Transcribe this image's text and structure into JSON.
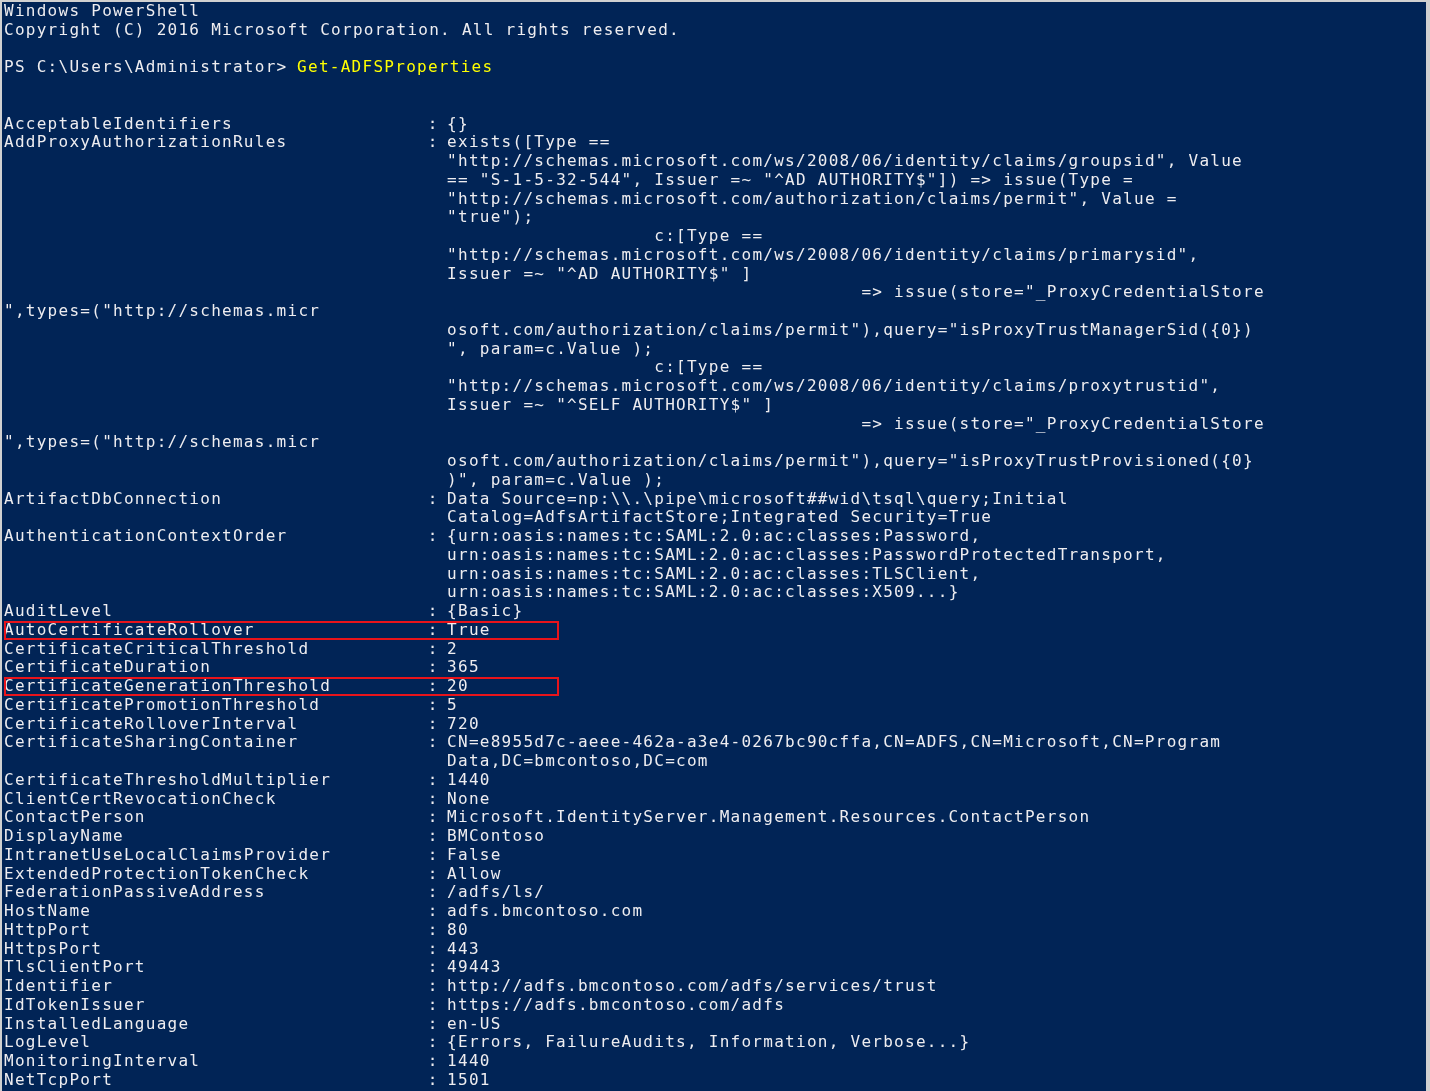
{
  "window": {
    "title": "Windows PowerShell"
  },
  "lines": [
    {
      "kind": "raw",
      "text": "Copyright (C) 2016 Microsoft Corporation. All rights reserved."
    },
    {
      "kind": "blank"
    },
    {
      "kind": "prompt",
      "prompt": "PS C:\\Users\\Administrator>",
      "command": "Get-ADFSProperties"
    },
    {
      "kind": "blank"
    },
    {
      "kind": "blank"
    },
    {
      "kind": "property",
      "name": "AcceptableIdentifiers",
      "sep": ":",
      "value": "{}",
      "highlighted": false
    },
    {
      "kind": "property",
      "name": "AddProxyAuthorizationRules",
      "sep": ":",
      "value": "exists([Type ==",
      "highlighted": false
    },
    {
      "kind": "cont",
      "text": "\"http://schemas.microsoft.com/ws/2008/06/identity/claims/groupsid\", Value"
    },
    {
      "kind": "cont",
      "text": "== \"S-1-5-32-544\", Issuer =~ \"^AD AUTHORITY$\"]) => issue(Type ="
    },
    {
      "kind": "cont",
      "text": "\"http://schemas.microsoft.com/authorization/claims/permit\", Value ="
    },
    {
      "kind": "cont",
      "text": "\"true\");"
    },
    {
      "kind": "cont",
      "text": "                   c:[Type =="
    },
    {
      "kind": "cont",
      "text": "\"http://schemas.microsoft.com/ws/2008/06/identity/claims/primarysid\","
    },
    {
      "kind": "cont",
      "text": "Issuer =~ \"^AD AUTHORITY$\" ]"
    },
    {
      "kind": "cont",
      "text": "                                      => issue(store=\"_ProxyCredentialStore"
    },
    {
      "kind": "raw",
      "text": "\",types=(\"http://schemas.micr"
    },
    {
      "kind": "cont",
      "text": "osoft.com/authorization/claims/permit\"),query=\"isProxyTrustManagerSid({0})"
    },
    {
      "kind": "cont",
      "text": "\", param=c.Value );"
    },
    {
      "kind": "cont",
      "text": "                   c:[Type =="
    },
    {
      "kind": "cont",
      "text": "\"http://schemas.microsoft.com/ws/2008/06/identity/claims/proxytrustid\","
    },
    {
      "kind": "cont",
      "text": "Issuer =~ \"^SELF AUTHORITY$\" ]"
    },
    {
      "kind": "cont",
      "text": "                                      => issue(store=\"_ProxyCredentialStore"
    },
    {
      "kind": "raw",
      "text": "\",types=(\"http://schemas.micr"
    },
    {
      "kind": "cont",
      "text": "osoft.com/authorization/claims/permit\"),query=\"isProxyTrustProvisioned({0}"
    },
    {
      "kind": "cont",
      "text": ")\", param=c.Value );"
    },
    {
      "kind": "property",
      "name": "ArtifactDbConnection",
      "sep": ":",
      "value": "Data Source=np:\\\\.\\pipe\\microsoft##wid\\tsql\\query;Initial",
      "highlighted": false
    },
    {
      "kind": "cont",
      "text": "Catalog=AdfsArtifactStore;Integrated Security=True"
    },
    {
      "kind": "property",
      "name": "AuthenticationContextOrder",
      "sep": ":",
      "value": "{urn:oasis:names:tc:SAML:2.0:ac:classes:Password,",
      "highlighted": false
    },
    {
      "kind": "cont",
      "text": "urn:oasis:names:tc:SAML:2.0:ac:classes:PasswordProtectedTransport,"
    },
    {
      "kind": "cont",
      "text": "urn:oasis:names:tc:SAML:2.0:ac:classes:TLSClient,"
    },
    {
      "kind": "cont",
      "text": "urn:oasis:names:tc:SAML:2.0:ac:classes:X509...}"
    },
    {
      "kind": "property",
      "name": "AuditLevel",
      "sep": ":",
      "value": "{Basic}",
      "highlighted": false
    },
    {
      "kind": "property",
      "name": "AutoCertificateRollover",
      "sep": ":",
      "value": "True",
      "highlighted": true
    },
    {
      "kind": "property",
      "name": "CertificateCriticalThreshold",
      "sep": ":",
      "value": "2",
      "highlighted": false
    },
    {
      "kind": "property",
      "name": "CertificateDuration",
      "sep": ":",
      "value": "365",
      "highlighted": false
    },
    {
      "kind": "property",
      "name": "CertificateGenerationThreshold",
      "sep": ":",
      "value": "20",
      "highlighted": true
    },
    {
      "kind": "property",
      "name": "CertificatePromotionThreshold",
      "sep": ":",
      "value": "5",
      "highlighted": false
    },
    {
      "kind": "property",
      "name": "CertificateRolloverInterval",
      "sep": ":",
      "value": "720",
      "highlighted": false
    },
    {
      "kind": "property",
      "name": "CertificateSharingContainer",
      "sep": ":",
      "value": "CN=e8955d7c-aeee-462a-a3e4-0267bc90cffa,CN=ADFS,CN=Microsoft,CN=Program",
      "highlighted": false
    },
    {
      "kind": "cont",
      "text": "Data,DC=bmcontoso,DC=com"
    },
    {
      "kind": "property",
      "name": "CertificateThresholdMultiplier",
      "sep": ":",
      "value": "1440",
      "highlighted": false
    },
    {
      "kind": "property",
      "name": "ClientCertRevocationCheck",
      "sep": ":",
      "value": "None",
      "highlighted": false
    },
    {
      "kind": "property",
      "name": "ContactPerson",
      "sep": ":",
      "value": "Microsoft.IdentityServer.Management.Resources.ContactPerson",
      "highlighted": false
    },
    {
      "kind": "property",
      "name": "DisplayName",
      "sep": ":",
      "value": "BMContoso",
      "highlighted": false
    },
    {
      "kind": "property",
      "name": "IntranetUseLocalClaimsProvider",
      "sep": ":",
      "value": "False",
      "highlighted": false
    },
    {
      "kind": "property",
      "name": "ExtendedProtectionTokenCheck",
      "sep": ":",
      "value": "Allow",
      "highlighted": false
    },
    {
      "kind": "property",
      "name": "FederationPassiveAddress",
      "sep": ":",
      "value": "/adfs/ls/",
      "highlighted": false
    },
    {
      "kind": "property",
      "name": "HostName",
      "sep": ":",
      "value": "adfs.bmcontoso.com",
      "highlighted": false
    },
    {
      "kind": "property",
      "name": "HttpPort",
      "sep": ":",
      "value": "80",
      "highlighted": false
    },
    {
      "kind": "property",
      "name": "HttpsPort",
      "sep": ":",
      "value": "443",
      "highlighted": false
    },
    {
      "kind": "property",
      "name": "TlsClientPort",
      "sep": ":",
      "value": "49443",
      "highlighted": false
    },
    {
      "kind": "property",
      "name": "Identifier",
      "sep": ":",
      "value": "http://adfs.bmcontoso.com/adfs/services/trust",
      "highlighted": false
    },
    {
      "kind": "property",
      "name": "IdTokenIssuer",
      "sep": ":",
      "value": "https://adfs.bmcontoso.com/adfs",
      "highlighted": false
    },
    {
      "kind": "property",
      "name": "InstalledLanguage",
      "sep": ":",
      "value": "en-US",
      "highlighted": false
    },
    {
      "kind": "property",
      "name": "LogLevel",
      "sep": ":",
      "value": "{Errors, FailureAudits, Information, Verbose...}",
      "highlighted": false
    },
    {
      "kind": "property",
      "name": "MonitoringInterval",
      "sep": ":",
      "value": "1440",
      "highlighted": false
    },
    {
      "kind": "property",
      "name": "NetTcpPort",
      "sep": ":",
      "value": "1501",
      "highlighted": false
    }
  ]
}
